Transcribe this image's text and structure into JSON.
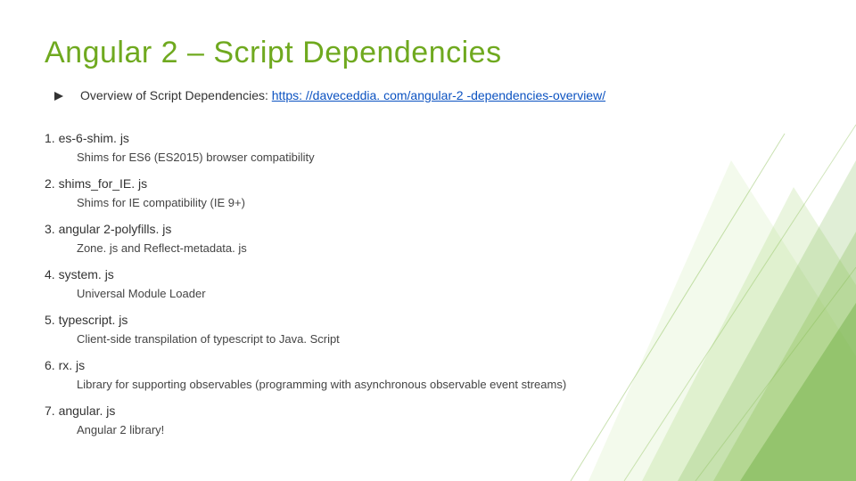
{
  "title": "Angular 2 – Script Dependencies",
  "overview": {
    "label": "Overview of Script Dependencies: ",
    "link_text": "https: //daveceddia. com/angular-2 -dependencies-overview/"
  },
  "dependencies": [
    {
      "num": "1.",
      "name": "es-6-shim. js",
      "desc": "Shims for ES6 (ES2015) browser compatibility"
    },
    {
      "num": "2.",
      "name": "shims_for_IE. js",
      "desc": "Shims for IE compatibility (IE 9+)"
    },
    {
      "num": "3.",
      "name": "angular 2-polyfills. js",
      "desc": "Zone. js and Reflect-metadata. js"
    },
    {
      "num": "4.",
      "name": "system. js",
      "desc": "Universal Module Loader"
    },
    {
      "num": "5.",
      "name": "typescript. js",
      "desc": "Client-side transpilation of typescript to Java. Script"
    },
    {
      "num": "6.",
      "name": "rx. js",
      "desc": "Library for supporting observables (programming with asynchronous observable event streams)"
    },
    {
      "num": "7.",
      "name": "angular. js",
      "desc": "Angular 2 library!"
    }
  ]
}
